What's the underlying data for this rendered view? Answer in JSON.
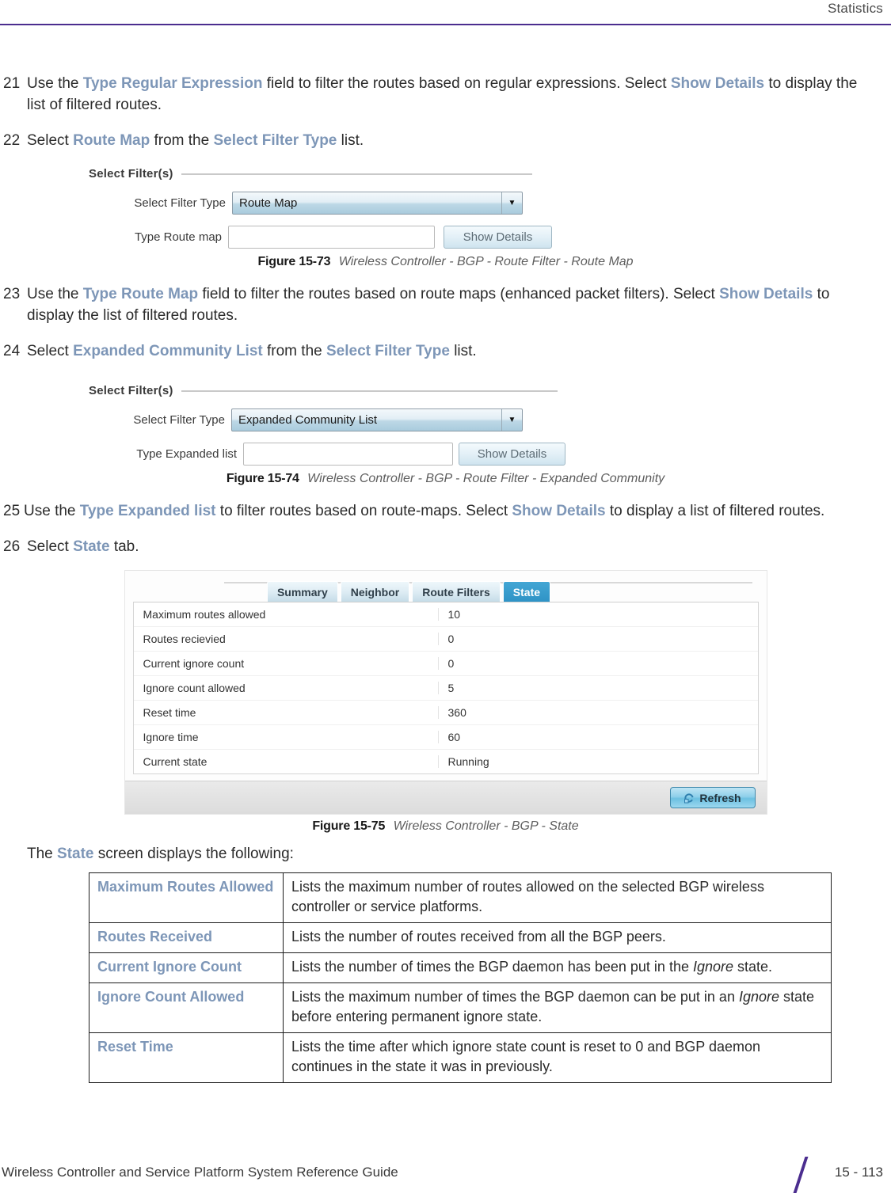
{
  "header": {
    "title": "Statistics",
    "rule_color": "#4b2d8f"
  },
  "accent_color": "#7d96b7",
  "steps": [
    {
      "num": "21",
      "parts": [
        {
          "t": "Use the ",
          "s": "plain"
        },
        {
          "t": "Type Regular Expression",
          "s": "kw"
        },
        {
          "t": " field to filter the routes based on regular expressions. Select ",
          "s": "plain"
        },
        {
          "t": "Show Details",
          "s": "kw"
        },
        {
          "t": " to display the list of filtered routes.",
          "s": "plain"
        }
      ]
    },
    {
      "num": "22",
      "parts": [
        {
          "t": "Select ",
          "s": "plain"
        },
        {
          "t": "Route Map",
          "s": "kw"
        },
        {
          "t": " from the ",
          "s": "plain"
        },
        {
          "t": "Select Filter Type",
          "s": "kw"
        },
        {
          "t": " list.",
          "s": "plain"
        }
      ]
    },
    {
      "num": "23",
      "parts": [
        {
          "t": "Use the ",
          "s": "plain"
        },
        {
          "t": "Type Route Map",
          "s": "kw"
        },
        {
          "t": " field to filter the routes based on route maps (enhanced packet filters). Select ",
          "s": "plain"
        },
        {
          "t": "Show Details",
          "s": "kw"
        },
        {
          "t": " to display the list of filtered routes.",
          "s": "plain"
        }
      ]
    },
    {
      "num": "24",
      "parts": [
        {
          "t": "Select ",
          "s": "plain"
        },
        {
          "t": "Expanded Community List",
          "s": "kw"
        },
        {
          "t": " from the ",
          "s": "plain"
        },
        {
          "t": "Select Filter Type",
          "s": "kw"
        },
        {
          "t": " list.",
          "s": "plain"
        }
      ]
    },
    {
      "num": "25",
      "parts": [
        {
          "t": "Use the ",
          "s": "plain"
        },
        {
          "t": "Type Expanded list",
          "s": "kw"
        },
        {
          "t": " to filter routes based on route-maps. Select ",
          "s": "plain"
        },
        {
          "t": "Show Details",
          "s": "kw"
        },
        {
          "t": " to display a list of filtered routes.",
          "s": "plain"
        }
      ]
    },
    {
      "num": "26",
      "parts": [
        {
          "t": "Select ",
          "s": "plain"
        },
        {
          "t": "State",
          "s": "kw"
        },
        {
          "t": " tab.",
          "s": "plain"
        }
      ]
    }
  ],
  "figure_73": {
    "panel_title": "Select Filter(s)",
    "filter_type_label": "Select Filter Type",
    "filter_type_value": "Route Map",
    "dropdown_icon": "chevron-down-icon",
    "field_label": "Type Route map",
    "field_value": "",
    "field_placeholder": "",
    "button_label": "Show Details",
    "caption_number": "Figure 15-73",
    "caption_title": "Wireless Controller - BGP - Route Filter - Route Map"
  },
  "figure_74": {
    "panel_title": "Select Filter(s)",
    "filter_type_label": "Select Filter Type",
    "filter_type_value": "Expanded Community List",
    "dropdown_icon": "chevron-down-icon",
    "field_label": "Type Expanded list",
    "field_value": "",
    "field_placeholder": "",
    "button_label": "Show Details",
    "caption_number": "Figure 15-74",
    "caption_title": "Wireless Controller - BGP - Route Filter - Expanded Community"
  },
  "figure_75": {
    "tabs": [
      {
        "label": "Summary",
        "active": false
      },
      {
        "label": "Neighbor",
        "active": false
      },
      {
        "label": "Route Filters",
        "active": false
      },
      {
        "label": "State",
        "active": true
      }
    ],
    "rows": [
      {
        "key": "Maximum routes allowed",
        "value": "10"
      },
      {
        "key": "Routes recievied",
        "value": "0"
      },
      {
        "key": "Current ignore count",
        "value": "0"
      },
      {
        "key": "Ignore count allowed",
        "value": "5"
      },
      {
        "key": "Reset time",
        "value": "360"
      },
      {
        "key": "Ignore time",
        "value": "60"
      },
      {
        "key": "Current state",
        "value": "Running"
      }
    ],
    "refresh_label": "Refresh",
    "refresh_icon": "refresh-icon",
    "caption_number": "Figure 15-75",
    "caption_title": "Wireless Controller - BGP - State"
  },
  "intro_table": {
    "lead_parts": [
      {
        "t": "The ",
        "s": "plain"
      },
      {
        "t": "State",
        "s": "kw"
      },
      {
        "t": " screen displays the following:",
        "s": "plain"
      }
    ],
    "rows": [
      {
        "term": "Maximum Routes Allowed",
        "desc_parts": [
          {
            "t": "Lists the maximum number of routes allowed on the selected BGP wireless controller or service platforms.",
            "s": "plain"
          }
        ]
      },
      {
        "term": "Routes Received",
        "desc_parts": [
          {
            "t": "Lists the number of routes received from all the BGP peers.",
            "s": "plain"
          }
        ]
      },
      {
        "term": "Current Ignore Count",
        "desc_parts": [
          {
            "t": "Lists the number of times the BGP daemon has been put in the ",
            "s": "plain"
          },
          {
            "t": "Ignore",
            "s": "em"
          },
          {
            "t": " state.",
            "s": "plain"
          }
        ]
      },
      {
        "term": "Ignore Count Allowed",
        "desc_parts": [
          {
            "t": "Lists the maximum number of times the BGP daemon can be put in an ",
            "s": "plain"
          },
          {
            "t": "Ignore",
            "s": "em"
          },
          {
            "t": " state before entering permanent ignore state.",
            "s": "plain"
          }
        ]
      },
      {
        "term": "Reset Time",
        "desc_parts": [
          {
            "t": "Lists the time after which ignore state count is reset to 0 and BGP daemon continues in the state it was in previously.",
            "s": "plain"
          }
        ]
      }
    ]
  },
  "footer": {
    "guide": "Wireless Controller and Service Platform System Reference Guide",
    "page": "15 - 113"
  }
}
